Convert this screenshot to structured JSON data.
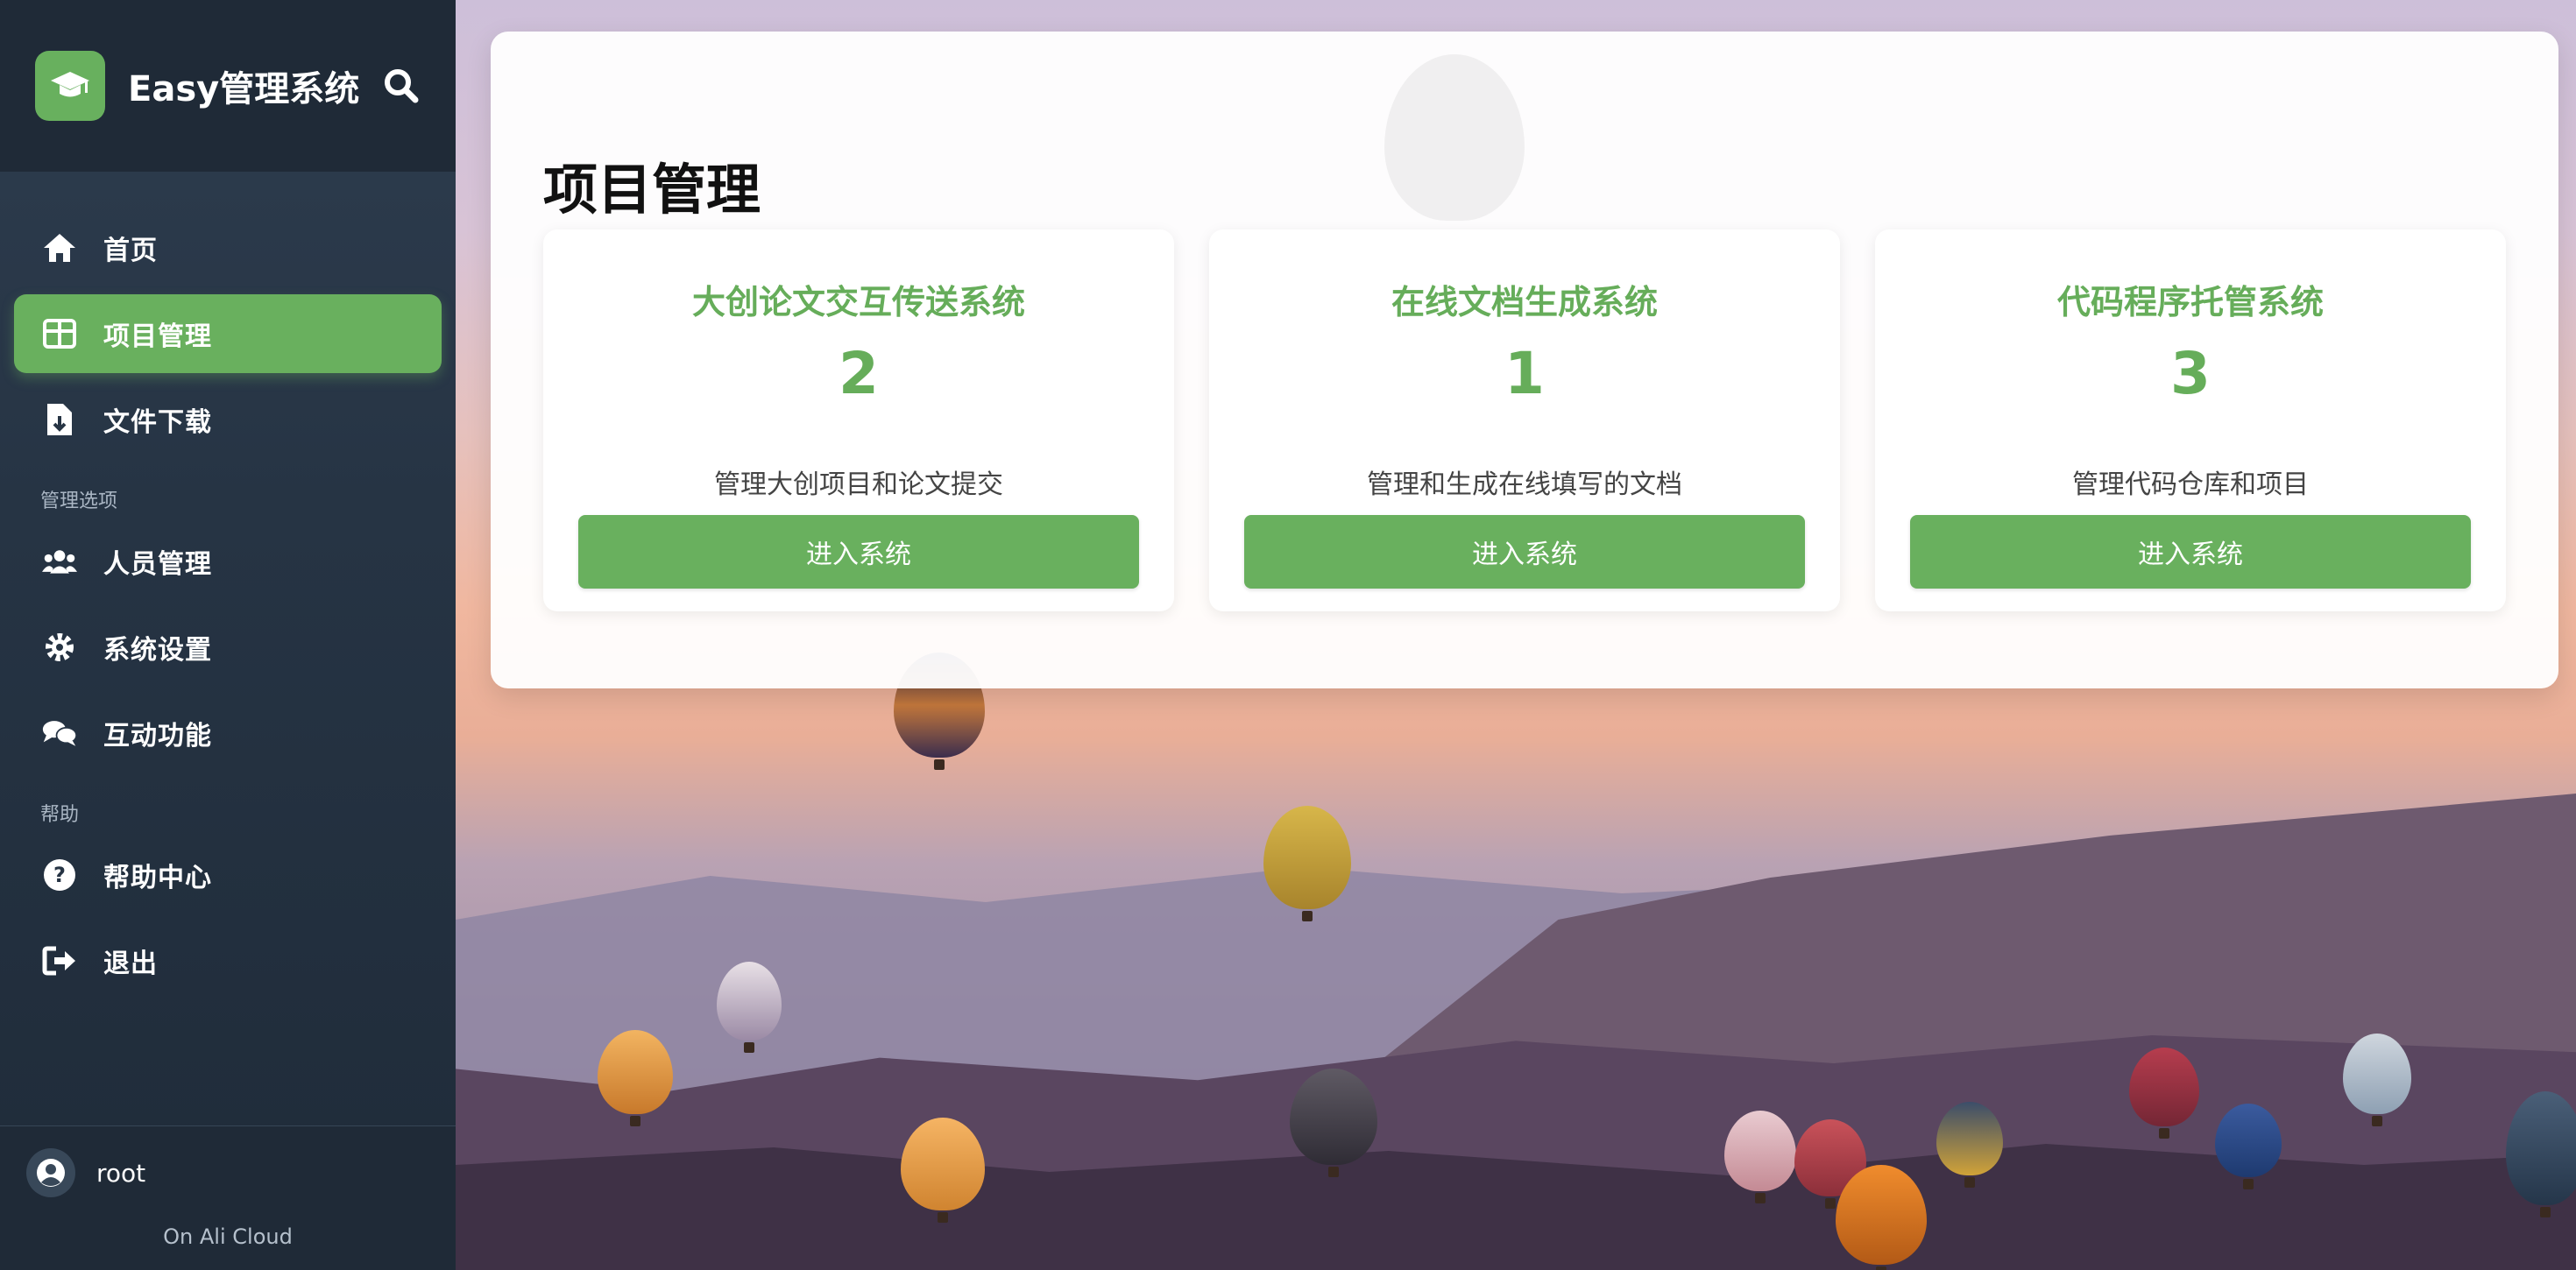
{
  "app": {
    "title": "Easy管理系统"
  },
  "sidebar": {
    "items": [
      {
        "label": "首页",
        "icon": "home-icon",
        "active": false
      },
      {
        "label": "项目管理",
        "icon": "grid-icon",
        "active": true
      },
      {
        "label": "文件下载",
        "icon": "file-download-icon",
        "active": false
      }
    ],
    "group_manage": "管理选项",
    "manage_items": [
      {
        "label": "人员管理",
        "icon": "users-icon"
      },
      {
        "label": "系统设置",
        "icon": "gear-icon"
      },
      {
        "label": "互动功能",
        "icon": "chat-icon"
      }
    ],
    "group_help": "帮助",
    "help_items": [
      {
        "label": "帮助中心",
        "icon": "question-icon"
      },
      {
        "label": "退出",
        "icon": "logout-icon"
      }
    ],
    "user": "root",
    "footer_note": "On Ali Cloud"
  },
  "main": {
    "title": "项目管理",
    "cards": [
      {
        "title": "大创论文交互传送系统",
        "count": "2",
        "description": "管理大创项目和论文提交",
        "button": "进入系统"
      },
      {
        "title": "在线文档生成系统",
        "count": "1",
        "description": "管理和生成在线填写的文档",
        "button": "进入系统"
      },
      {
        "title": "代码程序托管系统",
        "count": "3",
        "description": "管理代码仓库和项目",
        "button": "进入系统"
      }
    ]
  },
  "colors": {
    "accent": "#69b05e",
    "sidebar_bg": "#263444",
    "panel_bg": "#ffffff"
  }
}
